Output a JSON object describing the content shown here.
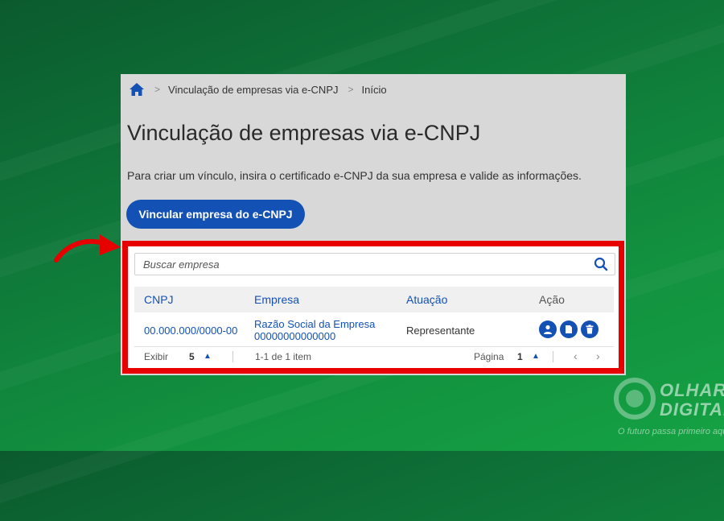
{
  "breadcrumb": {
    "home_icon": "home-icon",
    "items": [
      "Vinculação de empresas via e-CNPJ",
      "Início"
    ],
    "separator": ">"
  },
  "page": {
    "title": "Vinculação de empresas via e-CNPJ",
    "description": "Para criar um vínculo, insira o certificado e-CNPJ da sua empresa e valide as informações.",
    "primary_button": "Vincular empresa do e-CNPJ"
  },
  "search": {
    "placeholder": "Buscar empresa",
    "value": ""
  },
  "table": {
    "headers": [
      "CNPJ",
      "Empresa",
      "Atuação",
      "Ação"
    ],
    "rows": [
      {
        "cnpj": "00.000.000/0000-00",
        "empresa_line1": "Razão Social da Empresa",
        "empresa_line2": "00000000000000",
        "atuacao": "Representante",
        "actions": [
          "user-icon",
          "document-icon",
          "trash-icon"
        ]
      }
    ]
  },
  "pagination": {
    "show_label": "Exibir",
    "show_value": "5",
    "range_text": "1-1 de 1 item",
    "page_label": "Página",
    "page_value": "1"
  },
  "watermark": {
    "brand_line1": "OLHAR",
    "brand_line2": "DIGITAL",
    "tagline": "O futuro passa primeiro aqui"
  },
  "colors": {
    "primary": "#1351b4",
    "highlight_border": "#e60000",
    "arrow": "#e60000",
    "background_green": "#12913f"
  }
}
